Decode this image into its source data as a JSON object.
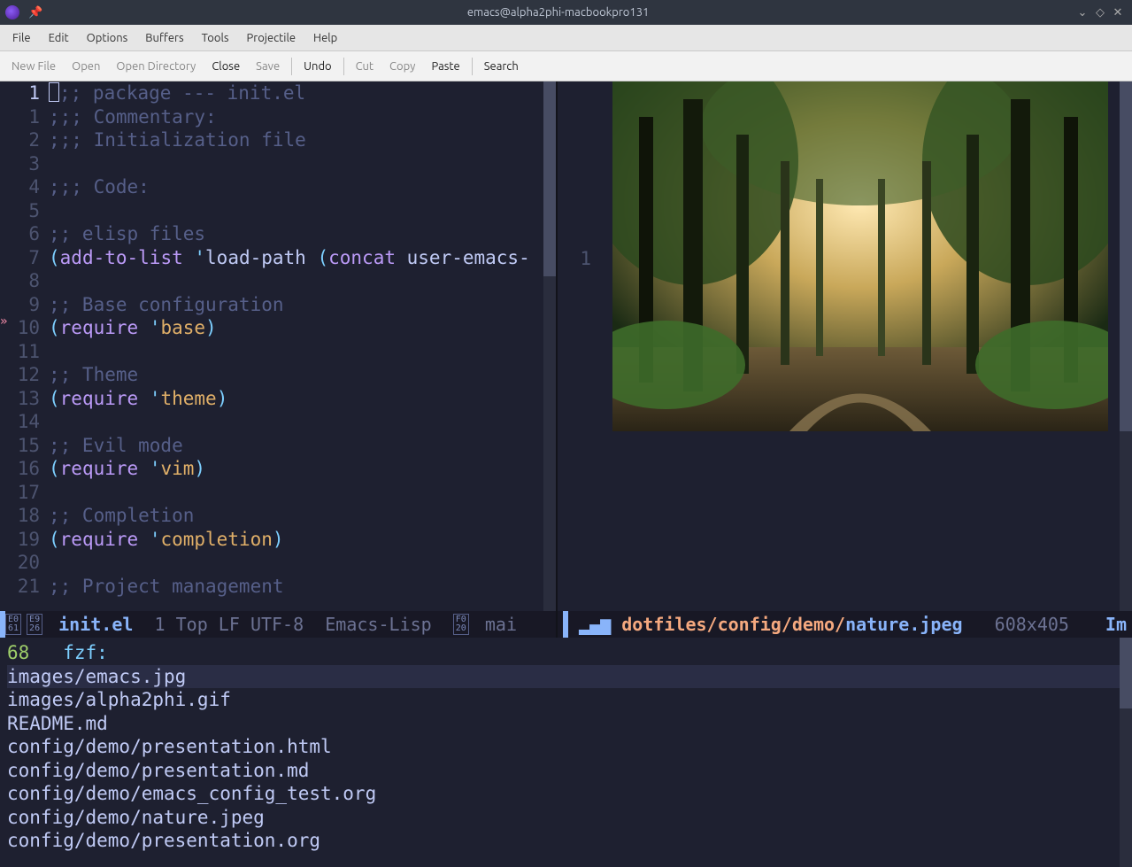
{
  "titlebar": {
    "title": "emacs@alpha2phi-macbookpro131"
  },
  "menubar": [
    "File",
    "Edit",
    "Options",
    "Buffers",
    "Tools",
    "Projectile",
    "Help"
  ],
  "toolbar": [
    {
      "label": "New File",
      "active": false
    },
    {
      "label": "Open",
      "active": false
    },
    {
      "label": "Open Directory",
      "active": false
    },
    {
      "label": "Close",
      "active": true
    },
    {
      "label": "Save",
      "active": false
    },
    {
      "sep": true
    },
    {
      "label": "Undo",
      "active": true
    },
    {
      "sep": true
    },
    {
      "label": "Cut",
      "active": false
    },
    {
      "label": "Copy",
      "active": false
    },
    {
      "label": "Paste",
      "active": true
    },
    {
      "sep": true
    },
    {
      "label": "Search",
      "active": true
    }
  ],
  "code": {
    "lines": [
      {
        "n": "1",
        "cur": true,
        "segs": [
          {
            "cursor": true
          },
          {
            "t": ";; package --- init.el",
            "c": "c-comment"
          }
        ]
      },
      {
        "n": "1",
        "segs": [
          {
            "t": ";;; Commentary:",
            "c": "c-comment"
          }
        ]
      },
      {
        "n": "2",
        "segs": [
          {
            "t": ";;; Initialization file",
            "c": "c-comment"
          }
        ]
      },
      {
        "n": "3",
        "segs": []
      },
      {
        "n": "4",
        "segs": [
          {
            "t": ";;; Code:",
            "c": "c-comment"
          }
        ]
      },
      {
        "n": "5",
        "segs": []
      },
      {
        "n": "6",
        "segs": [
          {
            "t": ";; elisp files",
            "c": "c-comment"
          }
        ]
      },
      {
        "n": "7",
        "segs": [
          {
            "t": "(",
            "c": "c-paren"
          },
          {
            "t": "add-to-list ",
            "c": "c-fn"
          },
          {
            "t": "'",
            "c": "c-quote"
          },
          {
            "t": "load-path ",
            "c": "c-plain"
          },
          {
            "t": "(",
            "c": "c-paren"
          },
          {
            "t": "concat ",
            "c": "c-fn"
          },
          {
            "t": "user-emacs-",
            "c": "c-plain"
          }
        ]
      },
      {
        "n": "8",
        "segs": []
      },
      {
        "n": "9",
        "segs": [
          {
            "t": ";; Base configuration",
            "c": "c-comment"
          }
        ]
      },
      {
        "n": "10",
        "segs": [
          {
            "t": "(",
            "c": "c-paren"
          },
          {
            "t": "require ",
            "c": "c-fn"
          },
          {
            "t": "'",
            "c": "c-quote"
          },
          {
            "t": "base",
            "c": "c-sym"
          },
          {
            "t": ")",
            "c": "c-paren"
          }
        ]
      },
      {
        "n": "11",
        "segs": []
      },
      {
        "n": "12",
        "segs": [
          {
            "t": ";; Theme",
            "c": "c-comment"
          }
        ]
      },
      {
        "n": "13",
        "segs": [
          {
            "t": "(",
            "c": "c-paren"
          },
          {
            "t": "require ",
            "c": "c-fn"
          },
          {
            "t": "'",
            "c": "c-quote"
          },
          {
            "t": "theme",
            "c": "c-sym"
          },
          {
            "t": ")",
            "c": "c-paren"
          }
        ]
      },
      {
        "n": "14",
        "segs": []
      },
      {
        "n": "15",
        "segs": [
          {
            "t": ";; Evil mode",
            "c": "c-comment"
          }
        ]
      },
      {
        "n": "16",
        "segs": [
          {
            "t": "(",
            "c": "c-paren"
          },
          {
            "t": "require ",
            "c": "c-fn"
          },
          {
            "t": "'",
            "c": "c-quote"
          },
          {
            "t": "vim",
            "c": "c-sym"
          },
          {
            "t": ")",
            "c": "c-paren"
          }
        ]
      },
      {
        "n": "17",
        "segs": []
      },
      {
        "n": "18",
        "segs": [
          {
            "t": ";; Completion",
            "c": "c-comment"
          }
        ]
      },
      {
        "n": "19",
        "segs": [
          {
            "t": "(",
            "c": "c-paren"
          },
          {
            "t": "require ",
            "c": "c-fn"
          },
          {
            "t": "'",
            "c": "c-quote"
          },
          {
            "t": "completion",
            "c": "c-sym"
          },
          {
            "t": ")",
            "c": "c-paren"
          }
        ]
      },
      {
        "n": "20",
        "segs": []
      },
      {
        "n": "21",
        "segs": [
          {
            "t": ";; Project management",
            "c": "c-comment"
          }
        ]
      }
    ]
  },
  "modeline_left": {
    "badge1_top": "E0",
    "badge1_bot": "61",
    "badge2_top": "E9",
    "badge2_bot": "26",
    "file": "init.el",
    "pos": "1",
    "loc": "Top",
    "eol": "LF",
    "enc": "UTF-8",
    "mode": "Emacs-Lisp",
    "badge3_top": "F0",
    "badge3_bot": "20",
    "branch": "mai"
  },
  "image_pane": {
    "line": "1"
  },
  "modeline_right": {
    "path": "dotfiles/config/demo/",
    "file": "nature.jpeg",
    "dim": "608x405",
    "mode": "Im"
  },
  "fzf": {
    "count": "68",
    "prompt": "fzf:",
    "items": [
      "images/emacs.jpg",
      "images/alpha2phi.gif",
      "README.md",
      "config/demo/presentation.html",
      "config/demo/presentation.md",
      "config/demo/emacs_config_test.org",
      "config/demo/nature.jpeg",
      "config/demo/presentation.org"
    ],
    "selected_index": 0
  }
}
